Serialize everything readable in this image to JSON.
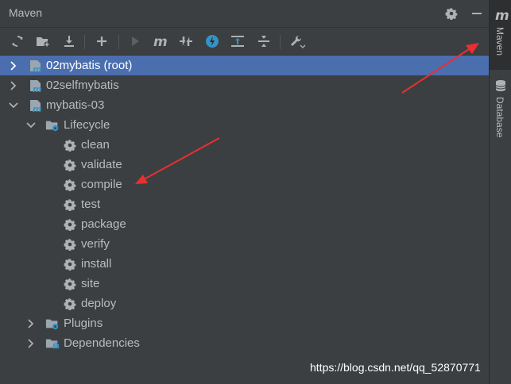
{
  "panel": {
    "title": "Maven"
  },
  "titlebar_icons": [
    "gear-icon",
    "minimize-icon"
  ],
  "toolbar": {
    "buttons": [
      "reload-icon",
      "add-folder-icon",
      "download-icon",
      "plus-icon",
      "run-icon",
      "maven-goal-icon",
      "toggle-offline-icon",
      "skip-tests-icon",
      "show-dependencies-icon",
      "collapse-all-icon",
      "settings-wrench-icon"
    ]
  },
  "tree": {
    "projects": [
      {
        "label": "02mybatis (root)",
        "selected": true,
        "expanded": false
      },
      {
        "label": "02selfmybatis",
        "selected": false,
        "expanded": false
      },
      {
        "label": "mybatis-03",
        "selected": false,
        "expanded": true
      }
    ],
    "lifecycle": {
      "label": "Lifecycle",
      "expanded": true
    },
    "goals": [
      "clean",
      "validate",
      "compile",
      "test",
      "package",
      "verify",
      "install",
      "site",
      "deploy"
    ],
    "plugins": {
      "label": "Plugins"
    },
    "dependencies": {
      "label": "Dependencies"
    }
  },
  "sidebar": {
    "maven_tab": {
      "icon_text": "m",
      "label": "Maven"
    },
    "database_tab": {
      "label": "Database"
    }
  },
  "watermark": "https://blog.csdn.net/qq_52870771",
  "colors": {
    "background": "#3c3f41",
    "selection": "#4b6eaf",
    "accent_blue": "#3592c4",
    "arrow_red": "#e83030"
  }
}
